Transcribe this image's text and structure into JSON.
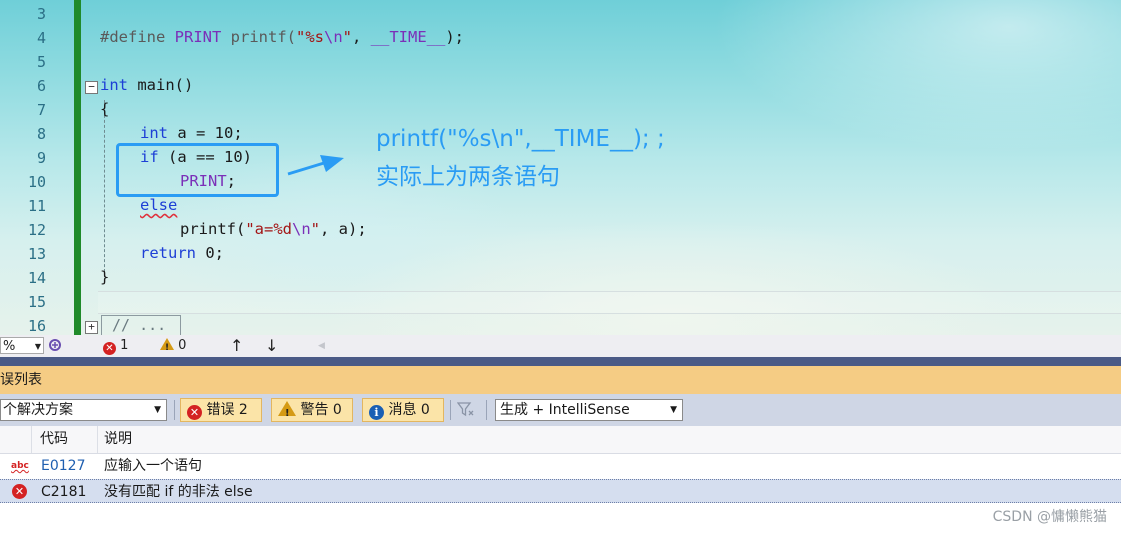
{
  "editor": {
    "line_numbers": [
      "3",
      "4",
      "5",
      "6",
      "7",
      "8",
      "9",
      "10",
      "11",
      "12",
      "13",
      "14",
      "15",
      "16"
    ],
    "lines": {
      "l4": {
        "pre": "#define ",
        "mac": "PRINT",
        "mid": " printf(",
        "str1": "\"%s",
        "esc": "\\n",
        "str2": "\"",
        ", ": ", ",
        "time": "__TIME__",
        "end": ");"
      },
      "l6": {
        "kw": "int",
        "rest": " main()"
      },
      "l7": "{",
      "l8": {
        "kw": "int",
        "rest": " a = 10;"
      },
      "l9": {
        "kw": "if",
        "rest": " (a == 10)"
      },
      "l10": {
        "mac": "PRINT",
        "rest": ";"
      },
      "l11": {
        "kw": "else"
      },
      "l12": {
        "pre": "printf(",
        "str1": "\"a=%d",
        "esc": "\\n",
        "str2": "\"",
        "rest": ", a);"
      },
      "l13": {
        "kw": "return",
        "rest": " 0;"
      },
      "l14": "}",
      "l16": "// ..."
    },
    "fold_minus": "−",
    "fold_plus": "+",
    "annotation_line1": "printf(\"%s\\n\",__TIME__); ;",
    "annotation_line2": "实际上为两条语句"
  },
  "statusbar": {
    "zoom": "%",
    "error_count": "1",
    "warning_count": "0",
    "up_arrow": "↑",
    "down_arrow": "↓",
    "left_arrow": "◀"
  },
  "error_list": {
    "title": "误列表",
    "scope": "个解决方案",
    "errors_label": "错误 2",
    "warnings_label": "警告 0",
    "messages_label": "消息 0",
    "source": "生成 + IntelliSense",
    "col_code": "代码",
    "col_desc": "说明",
    "rows": [
      {
        "icon": "abc",
        "code": "E0127",
        "desc": "应输入一个语句"
      },
      {
        "icon": "error",
        "code": "C2181",
        "desc": "没有匹配 if 的非法 else"
      }
    ]
  },
  "watermark": "CSDN @慵懒熊猫",
  "colors": {
    "accent": "#2a9cf4",
    "error": "#d42222",
    "warning": "#d59a15",
    "title_bar": "#f5cc84"
  }
}
